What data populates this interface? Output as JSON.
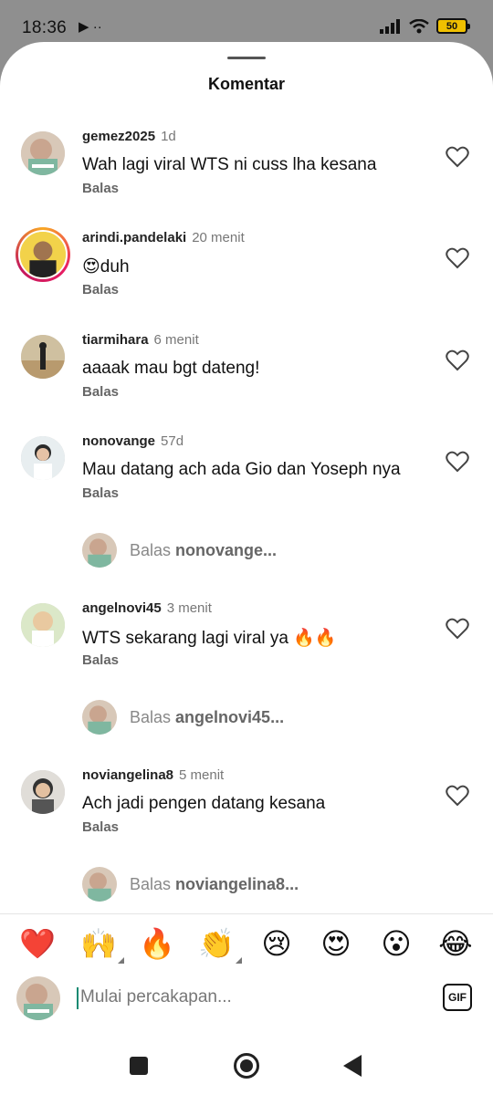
{
  "status_bar": {
    "time": "18:36",
    "extra": "▶ ··",
    "battery": "50"
  },
  "sheet": {
    "title": "Komentar"
  },
  "comments": [
    {
      "user": "gemez2025",
      "ago": "1d",
      "text": "Wah lagi viral WTS ni cuss lha kesana",
      "reply": "Balas"
    },
    {
      "user": "arindi.pandelaki",
      "ago": "20 menit",
      "text": "😍duh",
      "reply": "Balas"
    },
    {
      "user": "tiarmihara",
      "ago": "6 menit",
      "text": "aaaak mau bgt dateng!",
      "reply": "Balas"
    },
    {
      "user": "nonovange",
      "ago": "57d",
      "text": "Mau datang ach ada Gio dan Yoseph nya",
      "reply": "Balas",
      "reply_prompt": {
        "prefix": "Balas ",
        "target": "nonovange..."
      }
    },
    {
      "user": "angelnovi45",
      "ago": "3 menit",
      "text": "WTS sekarang lagi viral ya 🔥🔥",
      "reply": "Balas",
      "reply_prompt": {
        "prefix": "Balas ",
        "target": "angelnovi45..."
      }
    },
    {
      "user": "noviangelina8",
      "ago": "5 menit",
      "text": "Ach jadi pengen datang kesana",
      "reply": "Balas",
      "reply_prompt": {
        "prefix": "Balas ",
        "target": "noviangelina8..."
      }
    }
  ],
  "emoji_bar": [
    "❤️",
    "🙌",
    "🔥",
    "👏",
    "😢",
    "😍",
    "😮",
    "😂"
  ],
  "composer": {
    "placeholder": "Mulai percakapan...",
    "gif_label": "GIF"
  },
  "colors": {
    "accent": "#138a72",
    "story_ring": "#e91e63",
    "battery": "#f0c000"
  }
}
